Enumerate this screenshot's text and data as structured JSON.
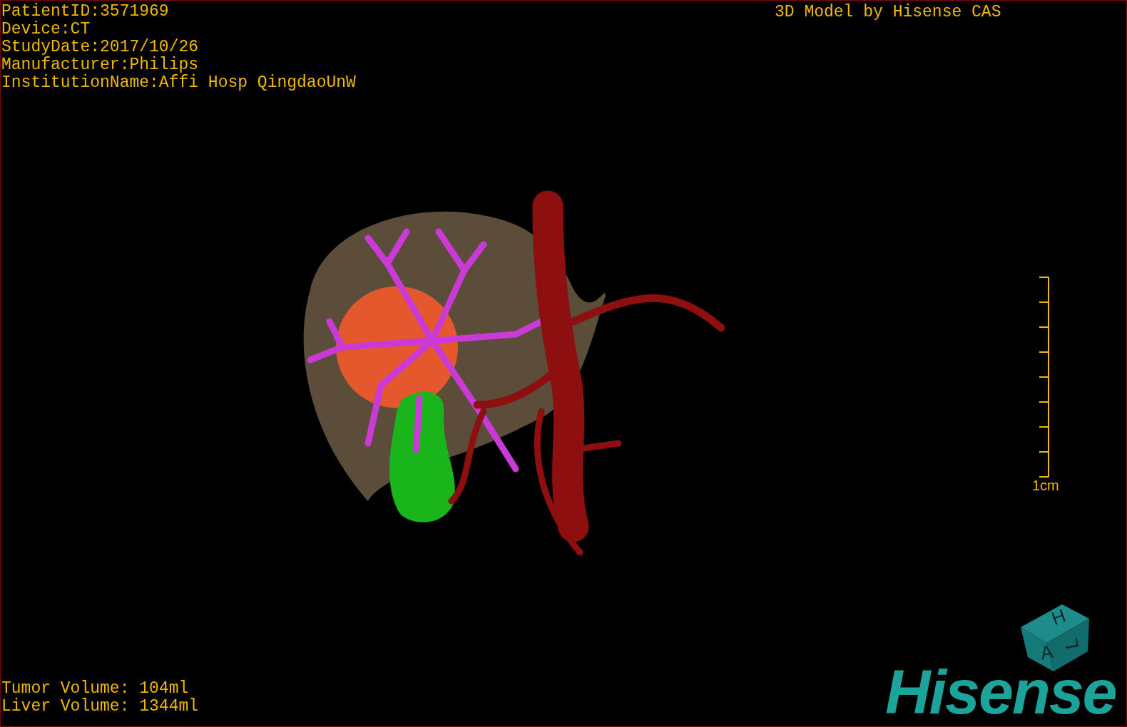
{
  "patient_info": [
    "PatientID:3571969",
    "Device:CT",
    "StudyDate:2017/10/26",
    "Manufacturer:Philips",
    "InstitutionName:Affi Hosp QingdaoUnW"
  ],
  "title": "3D Model by Hisense CAS",
  "scale_bar": {
    "label": "1cm"
  },
  "orientation_cube": {
    "faces": [
      {
        "kind": "top",
        "letter": "H"
      },
      {
        "kind": "front",
        "letter": "A"
      },
      {
        "kind": "side",
        "letter": "L"
      }
    ]
  },
  "logo": "Hisense",
  "volumes": [
    "Tumor Volume: 104ml",
    "Liver Volume: 1344ml"
  ]
}
